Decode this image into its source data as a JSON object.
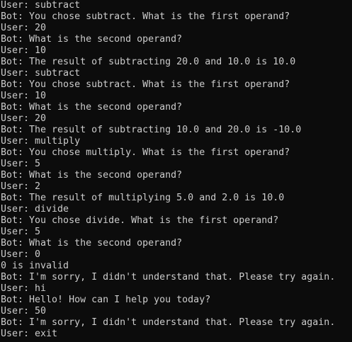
{
  "console": {
    "lines": [
      "User: subtract",
      "Bot: You chose subtract. What is the first operand?",
      "User: 20",
      "Bot: What is the second operand?",
      "User: 10",
      "Bot: The result of subtracting 20.0 and 10.0 is 10.0",
      "User: subtract",
      "Bot: You chose subtract. What is the first operand?",
      "User: 10",
      "Bot: What is the second operand?",
      "User: 20",
      "Bot: The result of subtracting 10.0 and 20.0 is -10.0",
      "User: multiply",
      "Bot: You chose multiply. What is the first operand?",
      "User: 5",
      "Bot: What is the second operand?",
      "User: 2",
      "Bot: The result of multiplying 5.0 and 2.0 is 10.0",
      "User: divide",
      "Bot: You chose divide. What is the first operand?",
      "User: 5",
      "Bot: What is the second operand?",
      "User: 0",
      "0 is invalid",
      "Bot: I'm sorry, I didn't understand that. Please try again.",
      "User: hi",
      "Bot: Hello! How can I help you today?",
      "User: 50",
      "Bot: I'm sorry, I didn't understand that. Please try again.",
      "User: exit"
    ]
  },
  "colors": {
    "background": "#0c0c0c",
    "text": "#cccccc"
  }
}
